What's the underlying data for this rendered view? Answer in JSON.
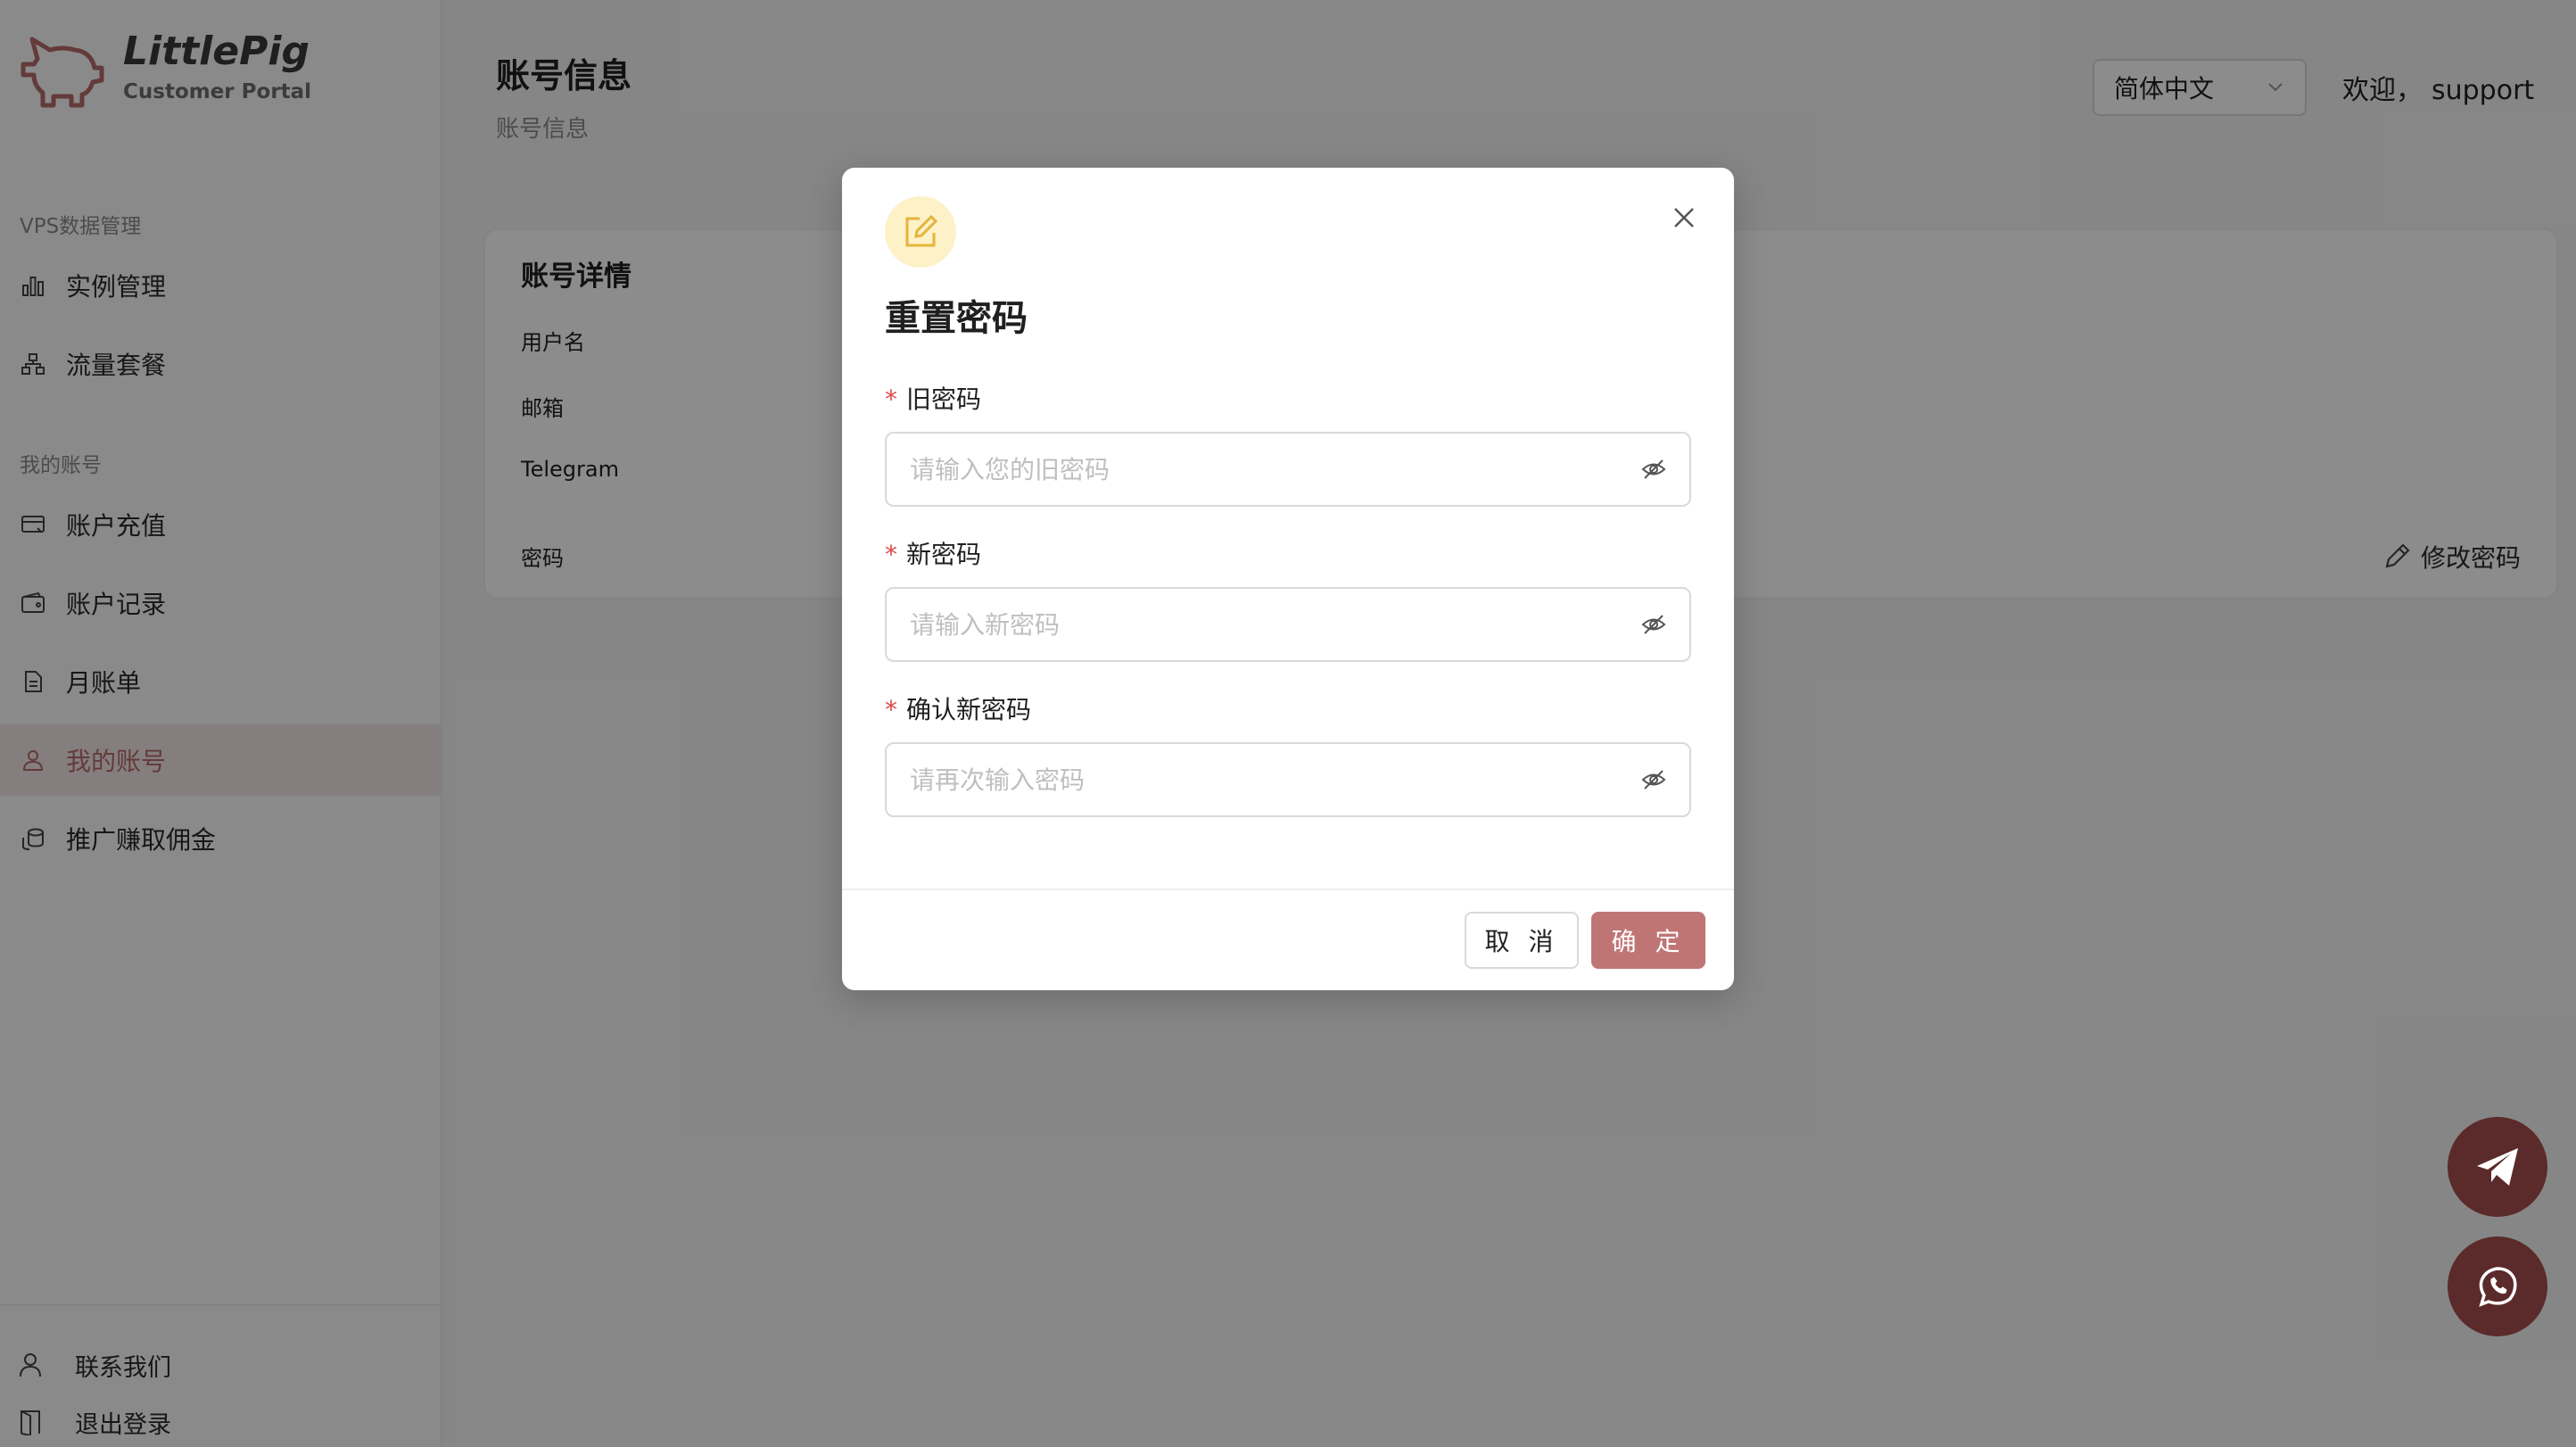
{
  "brand": {
    "title": "LittlePig",
    "subtitle": "Customer Portal"
  },
  "sidebar": {
    "groups": [
      {
        "label": "VPS数据管理",
        "items": [
          {
            "label": "实例管理",
            "icon": "bar-chart-icon"
          },
          {
            "label": "流量套餐",
            "icon": "network-icon"
          }
        ]
      },
      {
        "label": "我的账号",
        "items": [
          {
            "label": "账户充值",
            "icon": "card-icon"
          },
          {
            "label": "账户记录",
            "icon": "wallet-icon"
          },
          {
            "label": "月账单",
            "icon": "document-icon"
          },
          {
            "label": "我的账号",
            "icon": "user-icon",
            "active": true
          },
          {
            "label": "推广赚取佣金",
            "icon": "coins-icon"
          }
        ]
      }
    ],
    "bottom": [
      {
        "label": "联系我们",
        "icon": "user-icon"
      },
      {
        "label": "退出登录",
        "icon": "door-icon"
      }
    ]
  },
  "header": {
    "title": "账号信息",
    "breadcrumb": "账号信息",
    "language": "简体中文",
    "welcome": "欢迎，",
    "username": "support"
  },
  "card": {
    "title": "账号详情",
    "fields": [
      "用户名",
      "邮箱",
      "Telegram",
      "密码"
    ],
    "change_password": "修改密码"
  },
  "modal": {
    "title": "重置密码",
    "fields": [
      {
        "label": "旧密码",
        "placeholder": "请输入您的旧密码",
        "required": true
      },
      {
        "label": "新密码",
        "placeholder": "请输入新密码",
        "required": true
      },
      {
        "label": "确认新密码",
        "placeholder": "请再次输入密码",
        "required": true
      }
    ],
    "required_mark": "*",
    "cancel": "取 消",
    "ok": "确 定"
  },
  "colors": {
    "accent": "#c07575",
    "active_bg": "#f3e6e6",
    "fab": "#5b2a2a",
    "modal_icon_bg": "#fdf1c8",
    "required": "#e04848"
  }
}
